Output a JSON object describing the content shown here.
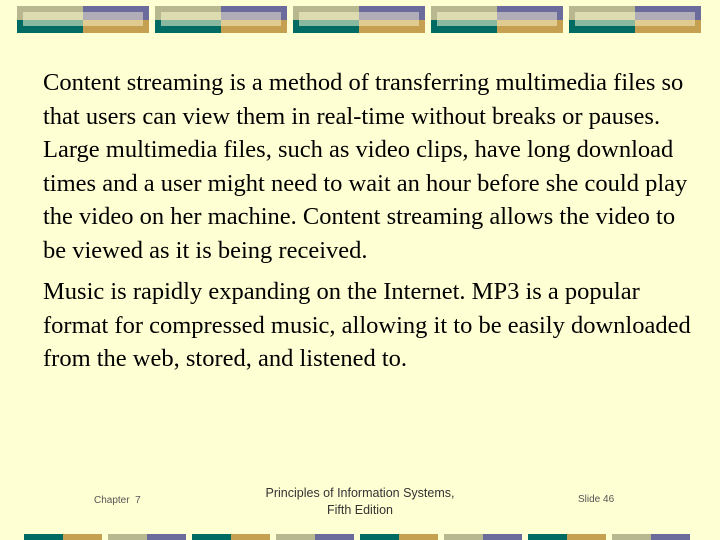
{
  "slide": {
    "paragraphs": [
      "Content streaming is a method of transferring multimedia files so that users can view them in real-time without breaks or pauses.  Large multimedia files, such as video clips, have long download times and a user might need to wait an hour before she could play the video on her machine.  Content streaming allows the video to be viewed as it is being received.",
      "Music is rapidly expanding on the Internet.  MP3 is a popular format for compressed music, allowing it to be easily downloaded from the web, stored, and listened to."
    ]
  },
  "footer": {
    "chapter": "Chapter  7",
    "book_title_line1": "Principles of Information Systems,",
    "book_title_line2": "Fifth Edition",
    "slide_number": "Slide 46"
  },
  "theme": {
    "background": "#ffffd4",
    "teal": "#006b63",
    "gold": "#c4a050",
    "khaki": "#b8b890",
    "purple": "#6b6b9c"
  }
}
